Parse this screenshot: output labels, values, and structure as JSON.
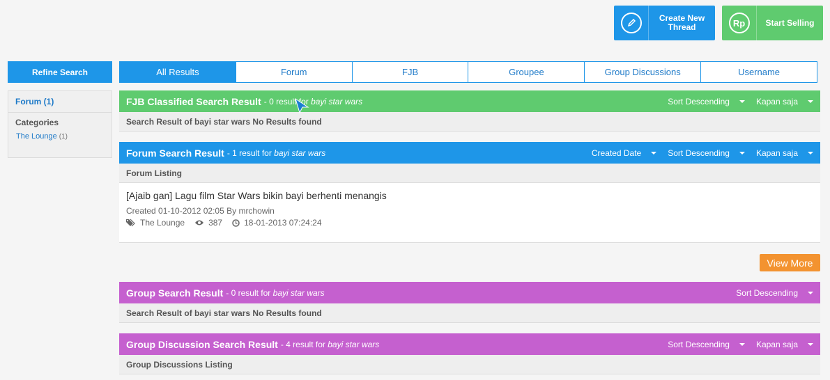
{
  "top_buttons": {
    "create_thread": "Create New Thread",
    "start_selling": "Start Selling",
    "rp_icon": "Rp"
  },
  "sidebar": {
    "refine_label": "Refine Search",
    "forum_label": "Forum (1)",
    "categories_label": "Categories",
    "items": [
      {
        "label": "The Lounge",
        "count": "(1)"
      }
    ]
  },
  "tabs": [
    "All Results",
    "Forum",
    "FJB",
    "Groupee",
    "Group Discussions",
    "Username"
  ],
  "sections": {
    "fjb": {
      "title": "FJB Classified Search Result",
      "sub": "- 0 result for",
      "query": "bayi star wars",
      "sort": "Sort Descending",
      "time": "Kapan saja",
      "bar": "Search Result of bayi star wars No Results found"
    },
    "forum": {
      "title": "Forum Search Result",
      "sub": "- 1 result for",
      "query": "bayi star wars",
      "created": "Created Date",
      "sort": "Sort Descending",
      "time": "Kapan saja",
      "bar": "Forum Listing",
      "thread": {
        "title": "[Ajaib gan] Lagu film Star Wars bikin bayi berhenti menangis",
        "meta": "Created 01-10-2012 02:05 By mrchowin",
        "category": "The Lounge",
        "views": "387",
        "last_post": "18-01-2013 07:24:24"
      },
      "view_more": "View More"
    },
    "group": {
      "title": "Group Search Result",
      "sub": "- 0 result for",
      "query": "bayi star wars",
      "sort": "Sort Descending",
      "bar": "Search Result of bayi star wars No Results found"
    },
    "group_discussion": {
      "title": "Group Discussion Search Result",
      "sub": "- 4 result for",
      "query": "bayi star wars",
      "sort": "Sort Descending",
      "time": "Kapan saja",
      "bar": "Group Discussions Listing"
    }
  },
  "colors": {
    "blue": "#1e96e8",
    "green": "#5fcb6f",
    "purple": "#c560cf",
    "orange": "#f39330"
  }
}
